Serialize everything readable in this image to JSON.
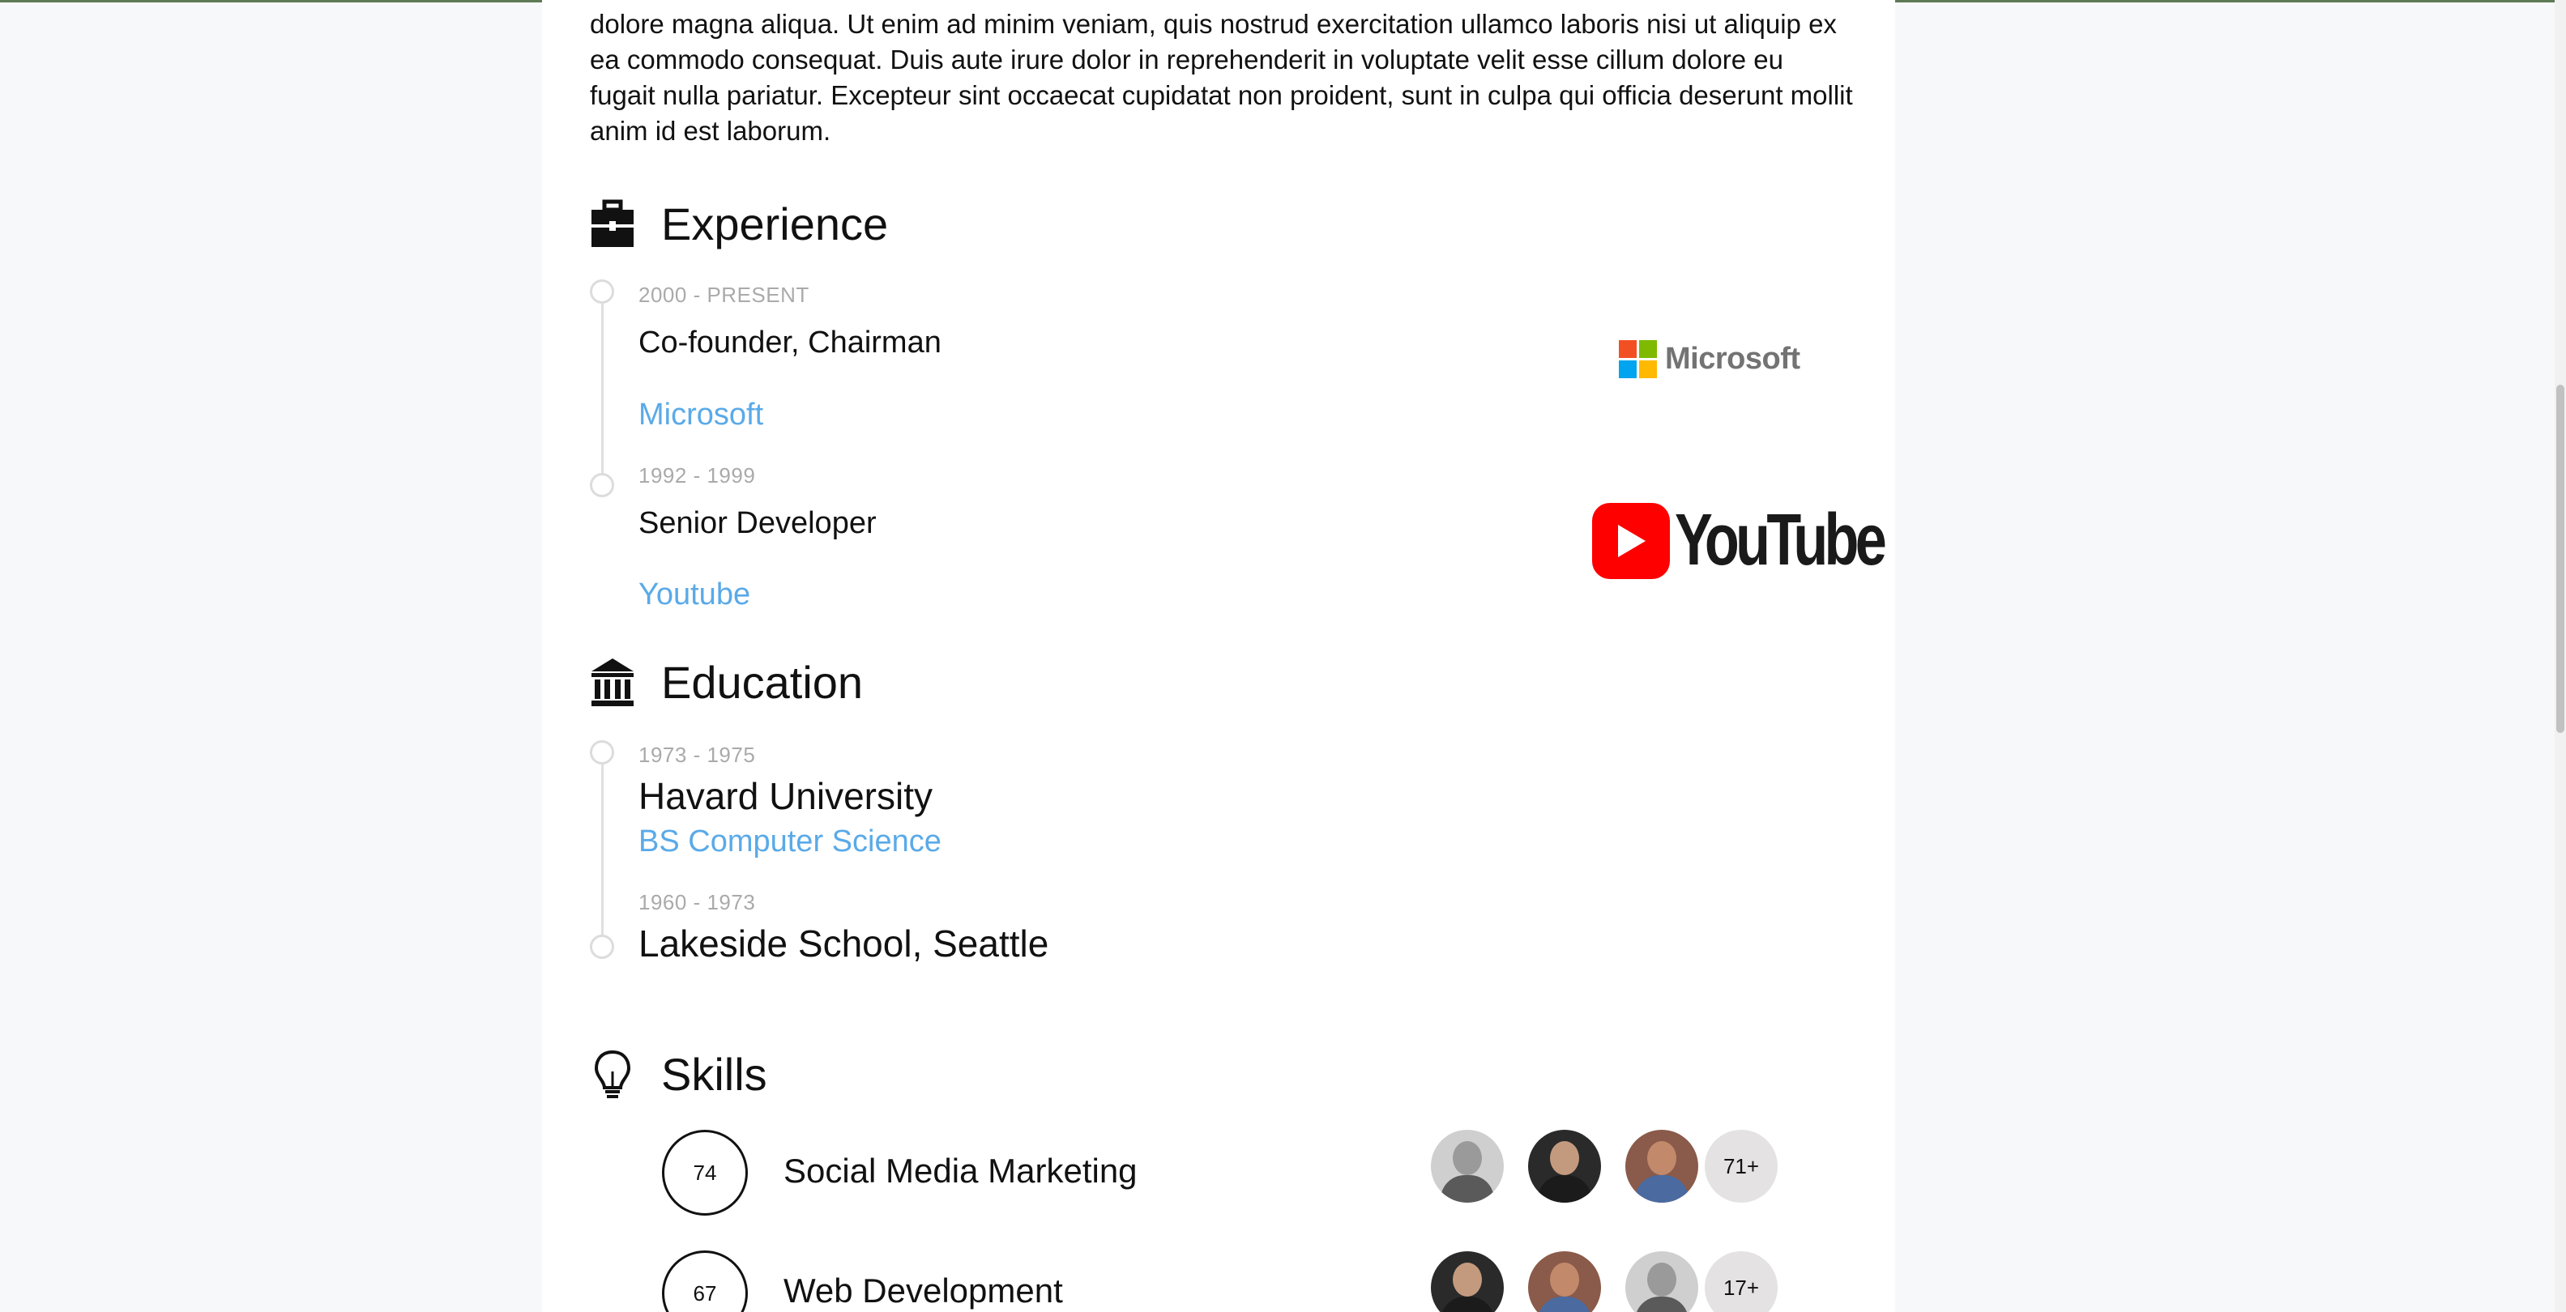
{
  "about": {
    "text": "dolore magna aliqua. Ut enim ad minim veniam, quis nostrud exercitation ullamco laboris nisi ut aliquip ex ea commodo consequat. Duis aute irure dolor in reprehenderit in voluptate velit esse cillum dolore eu fugait nulla pariatur. Excepteur sint occaecat cupidatat non proident, sunt in culpa qui officia deserunt mollit anim id est laborum."
  },
  "experience": {
    "title": "Experience",
    "icon": "briefcase-icon",
    "items": [
      {
        "date": "2000 - PRESENT",
        "role": "Co-founder, Chairman",
        "company": "Microsoft",
        "logo_text": "Microsoft"
      },
      {
        "date": "1992 - 1999",
        "role": "Senior Developer",
        "company": "Youtube",
        "logo_text": "YouTube"
      }
    ]
  },
  "education": {
    "title": "Education",
    "icon": "institution-icon",
    "items": [
      {
        "date": "1973 - 1975",
        "school": "Havard University",
        "degree": "BS Computer Science"
      },
      {
        "date": "1960 - 1973",
        "school": "Lakeside School, Seattle"
      }
    ]
  },
  "skills": {
    "title": "Skills",
    "icon": "lightbulb-icon",
    "items": [
      {
        "score": "74",
        "name": "Social Media Marketing",
        "more": "71+"
      },
      {
        "score": "67",
        "name": "Web Development",
        "more": "17+"
      }
    ]
  },
  "colors": {
    "accent_link": "#5aaae8",
    "date_gray": "#aaaaaa",
    "youtube_red": "#ff0000",
    "ms_red": "#f25022",
    "ms_green": "#7fba00",
    "ms_blue": "#00a4ef",
    "ms_yellow": "#ffb900"
  }
}
